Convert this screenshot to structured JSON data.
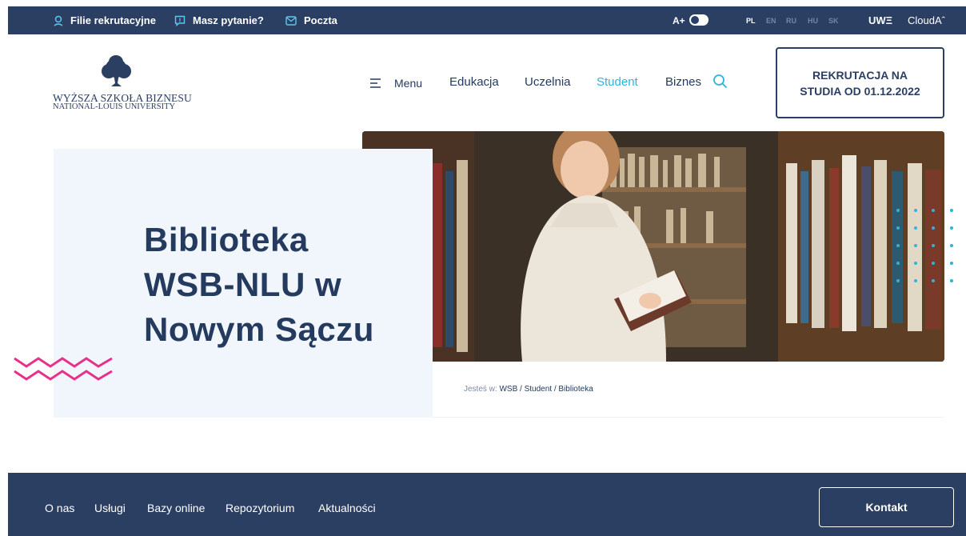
{
  "topbar": {
    "links": [
      {
        "label": "Filie rekrutacyjne",
        "icon": "location-pin-icon"
      },
      {
        "label": "Masz pytanie?",
        "icon": "chat-question-icon"
      },
      {
        "label": "Poczta",
        "icon": "mail-icon"
      }
    ],
    "font_size_label": "A+",
    "languages": [
      "PL",
      "EN",
      "RU",
      "HU",
      "SK"
    ],
    "active_language": "PL",
    "partner_links": [
      "UWΞ",
      "CloudAˆ"
    ]
  },
  "header": {
    "logo_line1": "WYŻSZA SZKOŁA BIZNESU",
    "logo_line2": "NATIONAL-LOUIS UNIVERSITY",
    "menu_label": "Menu",
    "nav": [
      "Edukacja",
      "Uczelnia",
      "Student",
      "Biznes"
    ],
    "active_nav": "Student",
    "recruitment_button": "REKRUTACJA NA STUDIA OD 01.12.2022"
  },
  "hero": {
    "title": "Biblioteka WSB-NLU w Nowym Sączu"
  },
  "breadcrumb": {
    "prefix": "Jesteś w:",
    "path": "WSB / Student / Biblioteka"
  },
  "footer_nav": {
    "items": [
      "O nas",
      "Usługi",
      "Bazy online",
      "Repozytorium",
      "Aktualności"
    ],
    "contact_button": "Kontakt"
  },
  "colors": {
    "navy": "#2b3f63",
    "accent_cyan": "#2fb3dc",
    "accent_pink": "#e8308a",
    "panel_bg": "#f1f6fc"
  }
}
